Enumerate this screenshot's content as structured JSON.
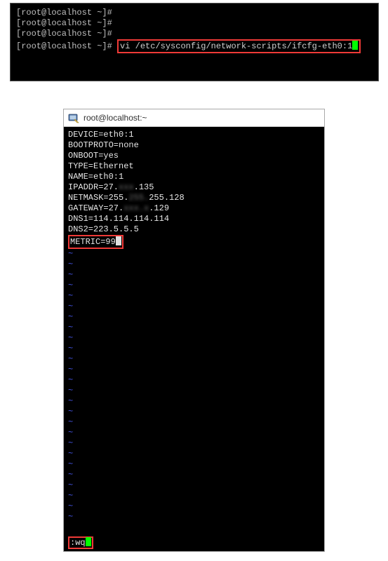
{
  "top_terminal": {
    "prompt1": "[root@localhost ~]#",
    "prompt2": "[root@localhost ~]#",
    "prompt3": "[root@localhost ~]#",
    "prompt4_prefix": "[root@localhost ~]#",
    "command": "vi /etc/sysconfig/network-scripts/ifcfg-eth0:1"
  },
  "vi_window": {
    "title": "root@localhost:~",
    "lines": {
      "device": "DEVICE=eth0:1",
      "bootproto": "BOOTPROTO=none",
      "onboot": "ONBOOT=yes",
      "type": "TYPE=Ethernet",
      "name": "NAME=eth0:1",
      "ipaddr_prefix": "IPADDR=27.",
      "ipaddr_redacted": "xxx",
      "ipaddr_suffix": ".135",
      "netmask_prefix": "NETMASK=255.",
      "netmask_redacted": "255.",
      "netmask_suffix": "255.128",
      "gateway_prefix": "GATEWAY=27.",
      "gateway_redacted": "xxx.x",
      "gateway_suffix": ".129",
      "dns1": "DNS1=114.114.114.114",
      "dns2": "DNS2=223.5.5.5",
      "metric": "METRIC=99"
    },
    "tilde": "~",
    "command_line": ":wq"
  }
}
